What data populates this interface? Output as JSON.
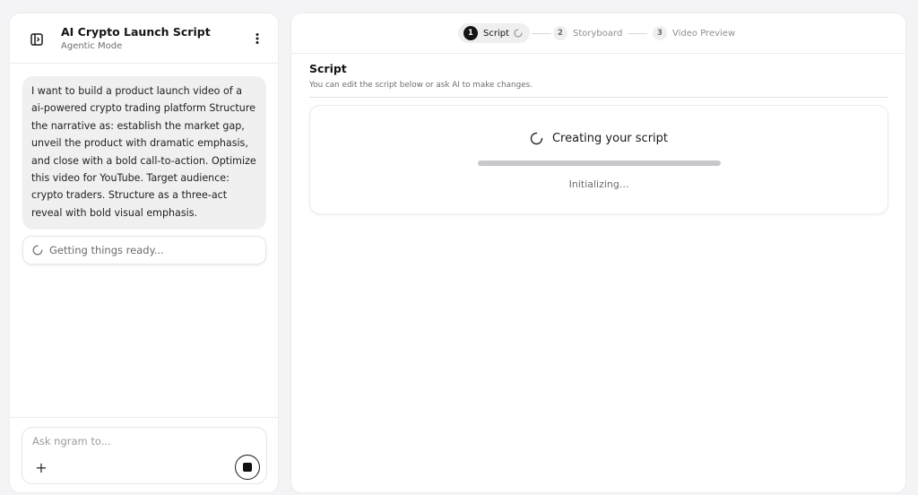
{
  "project": {
    "title": "AI Crypto Launch Script",
    "mode": "Agentic Mode"
  },
  "icons": {
    "sidebar_toggle": "sidebar-toggle-icon",
    "more": "more-vertical-icon",
    "spinner": "spinner-icon",
    "add": "plus-icon",
    "stop": "stop-icon"
  },
  "chat": {
    "user_message": "I want to build a product launch video of a ai-powered crypto trading platform Structure the narrative as: establish the market gap, unveil the product with dramatic emphasis, and close with a bold call-to-action. Optimize this video for YouTube. Target audience: crypto traders. Structure as a three-act reveal with bold visual emphasis.",
    "status": "Getting things ready..."
  },
  "composer": {
    "placeholder": "Ask ngram to...",
    "value": "",
    "add_symbol": "+"
  },
  "stepper": {
    "steps": [
      {
        "num": "1",
        "label": "Script",
        "state": "active"
      },
      {
        "num": "2",
        "label": "Storyboard",
        "state": "pending"
      },
      {
        "num": "3",
        "label": "Video Preview",
        "state": "pending"
      }
    ]
  },
  "script_section": {
    "title": "Script",
    "subtitle": "You can edit the script below or ask AI to make changes."
  },
  "generation": {
    "title": "Creating your script",
    "status": "Initializing...",
    "progress_fraction": 1.0
  },
  "colors": {
    "accent": "#151515",
    "background": "#f4f4f6",
    "panel": "#ffffff",
    "bubble": "#f0f0f1",
    "progress_track": "#e4e4e6",
    "progress_fill": "#c8c8cc"
  }
}
